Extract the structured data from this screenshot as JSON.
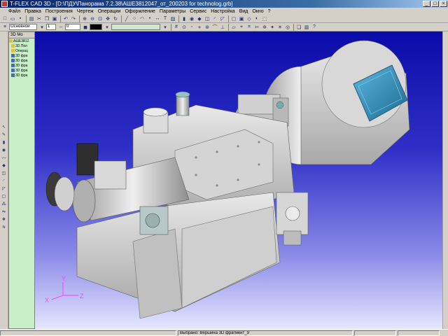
{
  "window": {
    "title": "T-FLEX CAD 3D - [D:\\ПДУ\\Панорама 7.2.38\\АШЕ3812047_от_200203 for technolog.grb]",
    "buttons": {
      "minimize": "_",
      "maximize": "□",
      "close": "×"
    }
  },
  "menu": [
    "Файл",
    "Правка",
    "Построения",
    "Чертеж",
    "Операции",
    "Оформление",
    "Параметры",
    "Сервис",
    "Настройка",
    "Вид",
    "Окно",
    "?"
  ],
  "toolbar2": {
    "layer_combo": "Основной",
    "width_combo": "1",
    "scale_combo": "0"
  },
  "tree": {
    "header": "3D Мо",
    "items": [
      {
        "label": "АШЕ3812",
        "icon": "y"
      },
      {
        "label": "3D Пол",
        "icon": "y"
      },
      {
        "label": "Операц",
        "icon": "y"
      },
      {
        "label": "3D фра",
        "icon": "b"
      },
      {
        "label": "3D фра",
        "icon": "b"
      },
      {
        "label": "3D фра",
        "icon": "b"
      },
      {
        "label": "3D фра",
        "icon": "b"
      },
      {
        "label": "3D фра",
        "icon": "b"
      }
    ]
  },
  "viewport": {
    "axes": {
      "x": "X",
      "y": "Y",
      "z": "Z"
    },
    "colors": {
      "bg_top": "#0a0aa8",
      "bg_bottom": "#e6e6ff",
      "part": "#c8c8c8",
      "glass": "#3a9ac0",
      "axis": "#ff40ff"
    }
  },
  "status": {
    "message": "Выбрано: Вершина 3D фрагмент_9",
    "cells": [
      "",
      "",
      ""
    ]
  }
}
